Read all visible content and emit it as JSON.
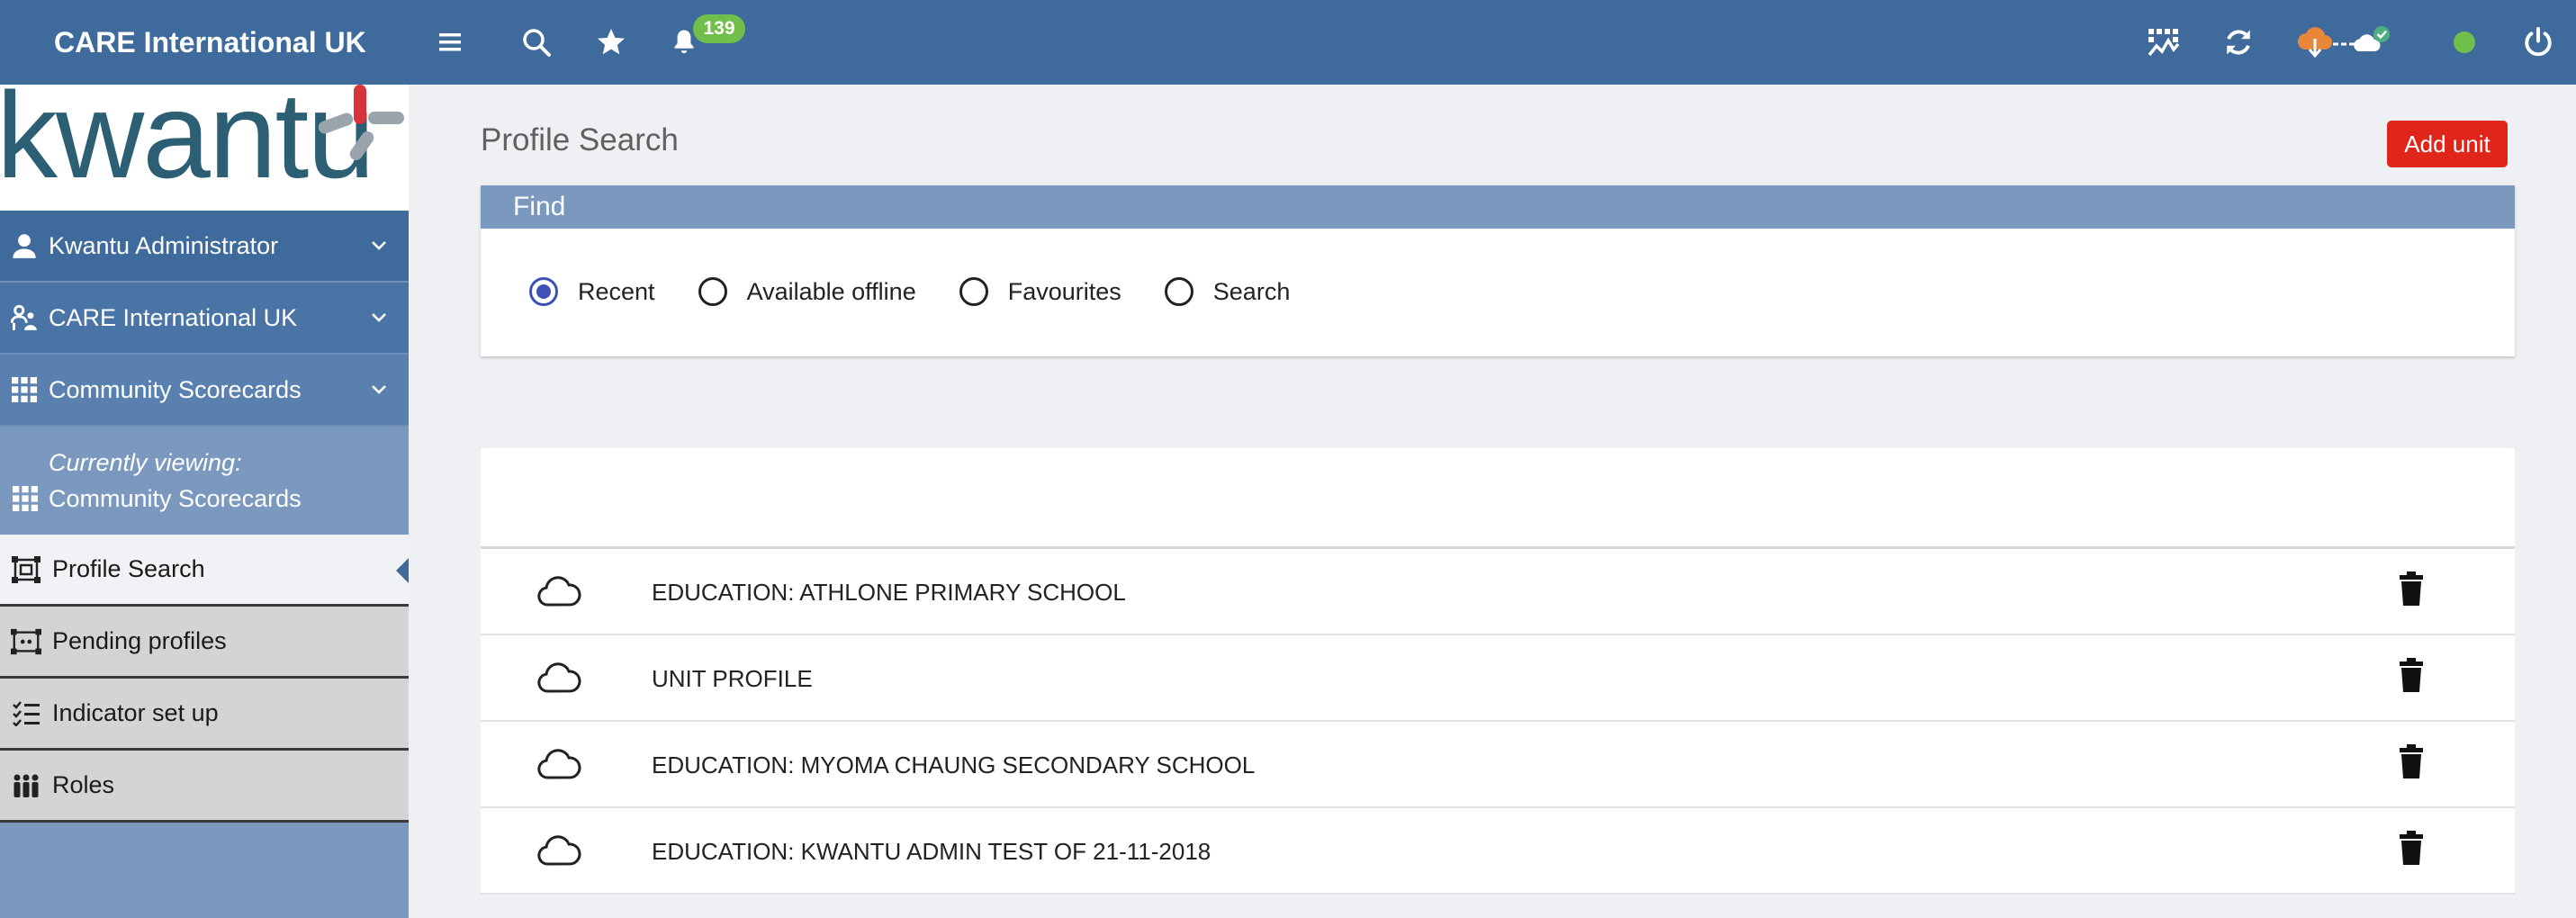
{
  "topbar": {
    "brand": "CARE International UK",
    "notifications_count": "139",
    "icons": [
      "menu-icon",
      "search-icon",
      "star-icon",
      "bell-icon",
      "dashboard-icon",
      "sync-icon",
      "cloud-status-icon",
      "online-status-icon",
      "power-icon"
    ]
  },
  "sidebar": {
    "logo_text": "kwantu",
    "sections": [
      {
        "label": "Kwantu Administrator",
        "icon": "user-icon"
      },
      {
        "label": "CARE International UK",
        "icon": "organisation-icon"
      },
      {
        "label": "Community Scorecards",
        "icon": "grid-icon"
      }
    ],
    "viewing_label": "Currently viewing:",
    "viewing_value": "Community Scorecards",
    "items": [
      {
        "label": "Profile Search",
        "icon": "profile-search-icon",
        "active": true
      },
      {
        "label": "Pending profiles",
        "icon": "pending-profiles-icon"
      },
      {
        "label": "Indicator set up",
        "icon": "checklist-icon"
      },
      {
        "label": "Roles",
        "icon": "people-icon"
      }
    ]
  },
  "main": {
    "title": "Profile Search",
    "add_unit_label": "Add unit",
    "find": {
      "header": "Find",
      "options": [
        "Recent",
        "Available offline",
        "Favourites",
        "Search"
      ],
      "selected": "Recent"
    },
    "rows": [
      "EDUCATION: ATHLONE PRIMARY SCHOOL",
      "UNIT PROFILE",
      "EDUCATION: MYOMA CHAUNG SECONDARY SCHOOL",
      "EDUCATION: KWANTU ADMIN TEST OF 21-11-2018"
    ]
  },
  "colors": {
    "topbar": "#3f6a9c",
    "sidebar": "#7b98bf",
    "add_button": "#e0251b",
    "badge": "#6fbf4a",
    "radio_selected": "#3f51b5"
  }
}
